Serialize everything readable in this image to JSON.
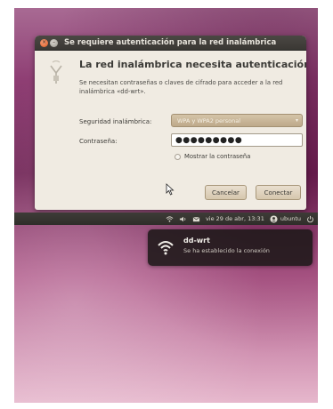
{
  "dialog": {
    "title": "Se requiere autenticación para la red inalámbrica",
    "heading": "La red inalámbrica necesita autenticación",
    "description": "Se necesitan contraseñas o claves de cifrado para acceder a la red inalámbrica «dd-wrt».",
    "security_label": "Seguridad inalámbrica:",
    "security_value": "WPA y WPA2 personal",
    "password_label": "Contraseña:",
    "password_value": "●●●●●●●●●",
    "show_password_label": "Mostrar la contraseña",
    "show_password_checked": false,
    "cancel_label": "Cancelar",
    "connect_label": "Conectar"
  },
  "panel": {
    "datetime": "vie 29 de abr, 13:31",
    "user": "ubuntu",
    "icons": [
      "wifi-icon",
      "volume-icon",
      "mail-icon",
      "user-icon",
      "power-icon"
    ]
  },
  "notification": {
    "title": "dd-wrt",
    "body": "Se ha establecido la conexión",
    "icon": "wifi-icon"
  },
  "colors": {
    "accent_orange": "#de5a22",
    "dialog_bg": "#f0ebe2",
    "panel_bg": "#3a3834"
  }
}
